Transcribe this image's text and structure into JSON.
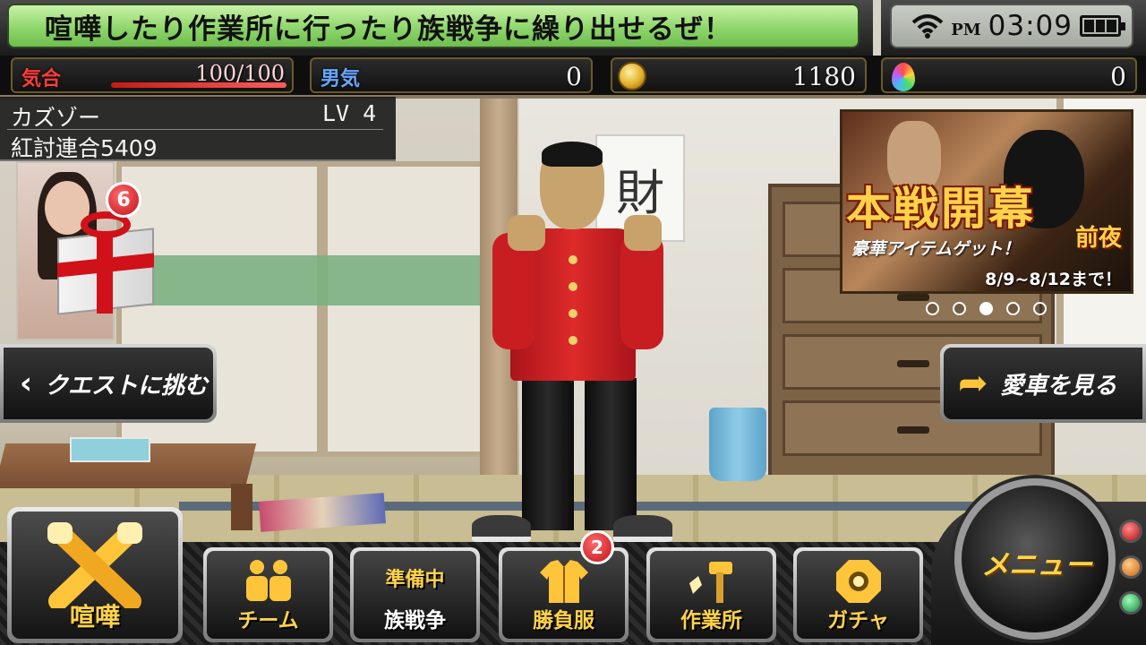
{
  "news": {
    "text": "喧嘩したり作業所に行ったり族戦争に繰り出せるぜ！"
  },
  "status": {
    "ampm": "PM",
    "time": "03:09",
    "icons": [
      "wifi-icon",
      "battery-icon"
    ]
  },
  "stats": {
    "kiai": {
      "label": "気合",
      "value": "100/100",
      "current": 100,
      "max": 100
    },
    "otoko": {
      "label": "男気",
      "value": "0"
    },
    "coins": {
      "value": "1180",
      "icon": "coin-icon"
    },
    "flame": {
      "value": "0",
      "icon": "flame-icon"
    }
  },
  "player": {
    "name": "カズゾー",
    "level": "LV 4",
    "team": "紅討連合5409"
  },
  "gift": {
    "badge": "6",
    "icon": "gift-icon"
  },
  "background": {
    "poster_text": "財"
  },
  "banner": {
    "title": "本戦開幕",
    "subtitle": "前夜",
    "caption": "豪華アイテムゲット！",
    "period": "8/9~8/12まで！",
    "pages": 5,
    "active_page": 3
  },
  "side": {
    "quest": "クエストに挑む",
    "car": "愛車を見る"
  },
  "menu": {
    "kenka": "喧嘩",
    "team": "チーム",
    "war_status": "準備中",
    "war": "族戦争",
    "outfit": "勝負服",
    "outfit_badge": "2",
    "workshop": "作業所",
    "gacha": "ガチャ",
    "main": "メニュー"
  },
  "colors": {
    "accent": "#ffd34a",
    "kiai": "#ff3b3b",
    "otoko": "#67a6ff",
    "lcd": "#8ed66b"
  }
}
